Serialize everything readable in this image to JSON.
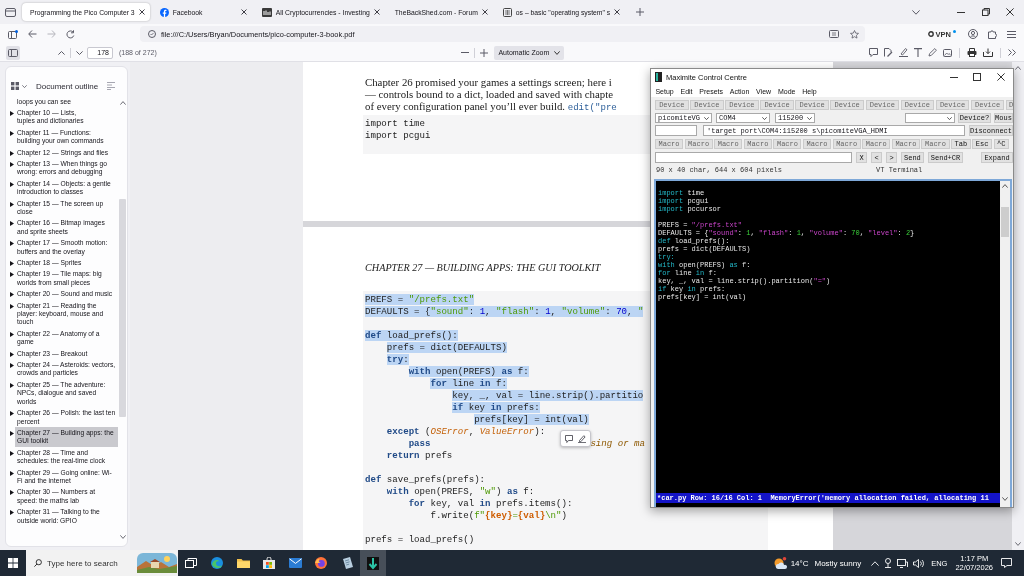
{
  "browser": {
    "tabs": [
      {
        "title": "Programming the Pico Computer 3",
        "kind": "plain",
        "selected": true
      },
      {
        "title": "Facebook",
        "kind": "roundlogo",
        "selected": false
      },
      {
        "title": "All Cryptocurrencies - Investing",
        "kind": "squarelogo",
        "selected": false
      },
      {
        "title": "TheBackShed.com - Forum",
        "kind": "plain",
        "selected": false
      },
      {
        "title": "os – basic \"operating system\" s",
        "kind": "framelogo",
        "selected": false
      }
    ],
    "url": "file:///C:/Users/Bryan/Documents/pico-computer-3-book.pdf",
    "vpn": "VPN"
  },
  "pdf_toolbar": {
    "sidebar_open": true,
    "page": "178",
    "page_count": "(188 of 272)",
    "zoom": "Automatic Zoom"
  },
  "outline": {
    "title": "Document outline",
    "items": [
      {
        "kind": "tail",
        "lines": [
          "loops you can see"
        ],
        "selected": false
      },
      {
        "kind": "chapter",
        "lines": [
          "Chapter 10 — Lists,",
          "tuples and dictionaries"
        ],
        "selected": false
      },
      {
        "kind": "chapter",
        "lines": [
          "Chapter 11 — Functions:",
          "building your own commands"
        ],
        "selected": false
      },
      {
        "kind": "chapter",
        "lines": [
          "Chapter 12 — Strings and files"
        ],
        "selected": false
      },
      {
        "kind": "chapter",
        "lines": [
          "Chapter 13 — When things go",
          "wrong: errors and debugging"
        ],
        "selected": false
      },
      {
        "kind": "chapter",
        "lines": [
          "Chapter 14 — Objects: a gentle",
          "introduction to classes"
        ],
        "selected": false
      },
      {
        "kind": "chapter",
        "lines": [
          "Chapter 15 — The screen up",
          "close"
        ],
        "selected": false
      },
      {
        "kind": "chapter",
        "lines": [
          "Chapter 16 — Bitmap images",
          "and sprite sheets"
        ],
        "selected": false
      },
      {
        "kind": "chapter",
        "lines": [
          "Chapter 17 — Smooth motion:",
          "buffers and the overlay"
        ],
        "selected": false
      },
      {
        "kind": "chapter",
        "lines": [
          "Chapter 18 — Sprites"
        ],
        "selected": false
      },
      {
        "kind": "chapter",
        "lines": [
          "Chapter 19 — Tile maps: big",
          "worlds from small pieces"
        ],
        "selected": false
      },
      {
        "kind": "chapter",
        "lines": [
          "Chapter 20 — Sound and music"
        ],
        "selected": false
      },
      {
        "kind": "chapter",
        "lines": [
          "Chapter 21 — Reading the",
          "player: keyboard, mouse and",
          "touch"
        ],
        "selected": false
      },
      {
        "kind": "chapter",
        "lines": [
          "Chapter 22 — Anatomy of a",
          "game"
        ],
        "selected": false
      },
      {
        "kind": "chapter",
        "lines": [
          "Chapter 23 — Breakout"
        ],
        "selected": false
      },
      {
        "kind": "chapter",
        "lines": [
          "Chapter 24 — Asteroids: vectors,",
          "crowds and particles"
        ],
        "selected": false
      },
      {
        "kind": "chapter",
        "lines": [
          "Chapter 25 — The adventure:",
          "NPCs, dialogue and saved",
          "worlds"
        ],
        "selected": false
      },
      {
        "kind": "chapter",
        "lines": [
          "Chapter 26 — Polish: the last ten",
          "percent"
        ],
        "selected": false
      },
      {
        "kind": "chapter",
        "lines": [
          "Chapter 27 — Building apps: the",
          "GUI toolkit"
        ],
        "selected": true
      },
      {
        "kind": "chapter",
        "lines": [
          "Chapter 28 — Time and",
          "schedules: the real-time clock"
        ],
        "selected": false
      },
      {
        "kind": "chapter",
        "lines": [
          "Chapter 29 — Going online: Wi-",
          "Fi and the internet"
        ],
        "selected": false
      },
      {
        "kind": "chapter",
        "lines": [
          "Chapter 30 — Numbers at",
          "speed: the maths lab"
        ],
        "selected": false
      },
      {
        "kind": "chapter",
        "lines": [
          "Chapter 31 — Talking to the",
          "outside world: GPIO"
        ],
        "selected": false
      }
    ]
  },
  "page_top": {
    "paragraph": [
      [
        {
          "kind": "text",
          "text": "Chapter 26 promised your games a settings screen; here i"
        }
      ],
      [
        {
          "kind": "text",
          "text": "— controls bound to a dict, loaded and saved with chapte"
        }
      ],
      [
        {
          "kind": "text",
          "text": "of every configuration panel you’ll ever build. "
        },
        {
          "kind": "code",
          "text": "edit(\"pre"
        }
      ]
    ],
    "code": [
      {
        "kind": "code",
        "selected": false,
        "tokens": [
          {
            "kind": "name",
            "text": "import time"
          }
        ]
      },
      {
        "kind": "code",
        "selected": false,
        "tokens": [
          {
            "kind": "name",
            "text": "import pcgui"
          }
        ]
      }
    ]
  },
  "page_bottom": {
    "heading": "CHAPTER 27 — BUILDING APPS: THE GUI TOOLKIT",
    "code": [
      {
        "kind": "code",
        "selected": true,
        "tokens": [
          {
            "kind": "name",
            "text": "PREFS = "
          },
          {
            "kind": "str",
            "text": "\"/prefs.txt\""
          }
        ]
      },
      {
        "kind": "code",
        "selected": true,
        "tokens": [
          {
            "kind": "name",
            "text": "DEFAULTS = {"
          },
          {
            "kind": "str",
            "text": "\"sound\""
          },
          {
            "kind": "name",
            "text": ": "
          },
          {
            "kind": "num",
            "text": "1"
          },
          {
            "kind": "name",
            "text": ", "
          },
          {
            "kind": "str",
            "text": "\"flash\""
          },
          {
            "kind": "name",
            "text": ": "
          },
          {
            "kind": "num",
            "text": "1"
          },
          {
            "kind": "name",
            "text": ", "
          },
          {
            "kind": "str",
            "text": "\"volume\""
          },
          {
            "kind": "name",
            "text": ": "
          },
          {
            "kind": "num",
            "text": "70"
          },
          {
            "kind": "name",
            "text": ", "
          },
          {
            "kind": "str",
            "text": "\""
          }
        ]
      },
      {
        "kind": "blank"
      },
      {
        "kind": "code",
        "selected": true,
        "tokens": [
          {
            "kind": "kw",
            "text": "def"
          },
          {
            "kind": "name",
            "text": " load_prefs():"
          }
        ],
        "children": [
          {
            "kind": "code",
            "selected": true,
            "tokens": [
              {
                "kind": "name",
                "text": "prefs = dict(DEFAULTS)"
              }
            ]
          },
          {
            "kind": "code",
            "selected": true,
            "tokens": [
              {
                "kind": "kw",
                "text": "try"
              },
              {
                "kind": "name",
                "text": ":"
              }
            ],
            "children": [
              {
                "kind": "code",
                "selected": true,
                "tokens": [
                  {
                    "kind": "kw",
                    "text": "with"
                  },
                  {
                    "kind": "name",
                    "text": " open(PREFS) "
                  },
                  {
                    "kind": "kw",
                    "text": "as"
                  },
                  {
                    "kind": "name",
                    "text": " f:"
                  }
                ],
                "children": [
                  {
                    "kind": "code",
                    "selected": true,
                    "tokens": [
                      {
                        "kind": "kw",
                        "text": "for"
                      },
                      {
                        "kind": "name",
                        "text": " line "
                      },
                      {
                        "kind": "kw",
                        "text": "in"
                      },
                      {
                        "kind": "name",
                        "text": " f:"
                      }
                    ],
                    "children": [
                      {
                        "kind": "code",
                        "selected": true,
                        "tokens": [
                          {
                            "kind": "name",
                            "text": "key, _, val = line.strip().partitio"
                          }
                        ]
                      },
                      {
                        "kind": "code",
                        "selected": true,
                        "tokens": [
                          {
                            "kind": "kw",
                            "text": "if"
                          },
                          {
                            "kind": "name",
                            "text": " key "
                          },
                          {
                            "kind": "kw",
                            "text": "in"
                          },
                          {
                            "kind": "name",
                            "text": " prefs:"
                          }
                        ],
                        "children": [
                          {
                            "kind": "code",
                            "selected": true,
                            "tokens": [
                              {
                                "kind": "name",
                                "text": "prefs[key] = int(val)"
                              }
                            ]
                          }
                        ]
                      }
                    ]
                  }
                ]
              }
            ]
          },
          {
            "kind": "code",
            "selected": false,
            "tokens": [
              {
                "kind": "kw",
                "text": "except"
              },
              {
                "kind": "name",
                "text": " ("
              },
              {
                "kind": "exc",
                "text": "OSError"
              },
              {
                "kind": "name",
                "text": ", "
              },
              {
                "kind": "exc",
                "text": "ValueError"
              },
              {
                "kind": "name",
                "text": "):"
              }
            ],
            "children": [
              {
                "kind": "code",
                "selected": false,
                "tokens": [
                  {
                    "kind": "kw",
                    "text": "pass"
                  },
                  {
                    "kind": "comment",
                    "text": "sing or ma"
                  }
                ]
              }
            ]
          },
          {
            "kind": "code",
            "selected": false,
            "tokens": [
              {
                "kind": "kw",
                "text": "return"
              },
              {
                "kind": "name",
                "text": " prefs"
              }
            ]
          }
        ]
      },
      {
        "kind": "blank"
      },
      {
        "kind": "code",
        "selected": false,
        "tokens": [
          {
            "kind": "kw",
            "text": "def"
          },
          {
            "kind": "name",
            "text": " save_prefs(prefs):"
          }
        ],
        "children": [
          {
            "kind": "code",
            "selected": false,
            "tokens": [
              {
                "kind": "kw",
                "text": "with"
              },
              {
                "kind": "name",
                "text": " open(PREFS, "
              },
              {
                "kind": "str",
                "text": "\"w\""
              },
              {
                "kind": "name",
                "text": ") "
              },
              {
                "kind": "kw",
                "text": "as"
              },
              {
                "kind": "name",
                "text": " f:"
              }
            ],
            "children": [
              {
                "kind": "code",
                "selected": false,
                "tokens": [
                  {
                    "kind": "kw",
                    "text": "for"
                  },
                  {
                    "kind": "name",
                    "text": " key, val "
                  },
                  {
                    "kind": "kw",
                    "text": "in"
                  },
                  {
                    "kind": "name",
                    "text": " prefs.items():"
                  }
                ],
                "children": [
                  {
                    "kind": "code",
                    "selected": false,
                    "tokens": [
                      {
                        "kind": "name",
                        "text": "f.write("
                      },
                      {
                        "kind": "str",
                        "text": "f\""
                      },
                      {
                        "kind": "interp",
                        "text": "{key}"
                      },
                      {
                        "kind": "str",
                        "text": "="
                      },
                      {
                        "kind": "interp",
                        "text": "{val}"
                      },
                      {
                        "kind": "str",
                        "text": "\\n\""
                      },
                      {
                        "kind": "name",
                        "text": ")"
                      }
                    ]
                  }
                ]
              }
            ]
          }
        ]
      },
      {
        "kind": "blank"
      },
      {
        "kind": "code",
        "selected": false,
        "tokens": [
          {
            "kind": "name",
            "text": "prefs = load_prefs()"
          }
        ]
      }
    ]
  },
  "maximite": {
    "title": "Maximite Control Centre",
    "menu": [
      "Setup",
      "Edit",
      "Presets",
      "Action",
      "View",
      "Mode",
      "Help"
    ],
    "device_buttons": [
      {
        "label": "Device",
        "disabled": true
      },
      {
        "label": "Device",
        "disabled": true
      },
      {
        "label": "Device",
        "disabled": true
      },
      {
        "label": "Device",
        "disabled": true
      },
      {
        "label": "Device",
        "disabled": true
      },
      {
        "label": "Device",
        "disabled": true
      },
      {
        "label": "Device",
        "disabled": true
      },
      {
        "label": "Device",
        "disabled": true
      },
      {
        "label": "Device",
        "disabled": true
      },
      {
        "label": "Device",
        "disabled": true
      },
      {
        "label": "D",
        "disabled": true
      }
    ],
    "board": "picomiteVG",
    "port": "COM4",
    "baud": "115200",
    "device_query": "Device?",
    "mouse": "Mous",
    "target": "'target port\\COM4:115200 s\\picomiteVGA_HDMI",
    "disconnect": "Disconnect",
    "macro_buttons": [
      {
        "label": "Macro",
        "disabled": true
      },
      {
        "label": "Macro",
        "disabled": true
      },
      {
        "label": "Macro",
        "disabled": true
      },
      {
        "label": "Macro",
        "disabled": true
      },
      {
        "label": "Macro",
        "disabled": true
      },
      {
        "label": "Macro",
        "disabled": true
      },
      {
        "label": "Macro",
        "disabled": true
      },
      {
        "label": "Macro",
        "disabled": true
      },
      {
        "label": "Macro",
        "disabled": true
      },
      {
        "label": "Macro",
        "disabled": true
      },
      {
        "label": "Tab",
        "disabled": false
      },
      {
        "label": "Esc",
        "disabled": false
      },
      {
        "label": "^C",
        "disabled": false
      }
    ],
    "send_buttons": [
      "X",
      "<",
      ">",
      "Send",
      "Send+CR"
    ],
    "expand": "Expand",
    "screen_info": "90 x 40 char, 644 x 604 pixels",
    "terminal_mode": "VT Terminal",
    "terminal": {
      "lines": [
        {
          "kind": "code",
          "tokens": [
            {
              "kind": "kw",
              "text": "import"
            },
            {
              "kind": "text",
              "text": " time"
            }
          ]
        },
        {
          "kind": "code",
          "tokens": [
            {
              "kind": "kw",
              "text": "import"
            },
            {
              "kind": "text",
              "text": " pcgui"
            }
          ]
        },
        {
          "kind": "code",
          "tokens": [
            {
              "kind": "kw",
              "text": "import"
            },
            {
              "kind": "text",
              "text": " pccursor"
            }
          ]
        },
        {
          "kind": "blank"
        },
        {
          "kind": "code",
          "tokens": [
            {
              "kind": "text",
              "text": "PREFS = "
            },
            {
              "kind": "str",
              "text": "\"/prefs.txt\""
            }
          ]
        },
        {
          "kind": "code",
          "tokens": [
            {
              "kind": "text",
              "text": "DEFAULTS = {"
            },
            {
              "kind": "str",
              "text": "\"sound\""
            },
            {
              "kind": "text",
              "text": ": "
            },
            {
              "kind": "num",
              "text": "1"
            },
            {
              "kind": "text",
              "text": ", "
            },
            {
              "kind": "str",
              "text": "\"flash\""
            },
            {
              "kind": "text",
              "text": ": "
            },
            {
              "kind": "num",
              "text": "1"
            },
            {
              "kind": "text",
              "text": ", "
            },
            {
              "kind": "str",
              "text": "\"volume\""
            },
            {
              "kind": "text",
              "text": ": "
            },
            {
              "kind": "num",
              "text": "70"
            },
            {
              "kind": "text",
              "text": ", "
            },
            {
              "kind": "str",
              "text": "\"level\""
            },
            {
              "kind": "text",
              "text": ": "
            },
            {
              "kind": "num",
              "text": "2"
            },
            {
              "kind": "text",
              "text": "}"
            }
          ]
        },
        {
          "kind": "code",
          "tokens": [
            {
              "kind": "kw",
              "text": "def"
            },
            {
              "kind": "text",
              "text": " load_prefs():"
            }
          ]
        },
        {
          "kind": "code",
          "tokens": [
            {
              "kind": "text",
              "text": "prefs = dict(DEFAULTS)"
            }
          ]
        },
        {
          "kind": "code",
          "tokens": [
            {
              "kind": "kw",
              "text": "try:"
            }
          ]
        },
        {
          "kind": "code",
          "tokens": [
            {
              "kind": "kw",
              "text": "with"
            },
            {
              "kind": "text",
              "text": " open(PREFS) "
            },
            {
              "kind": "kw",
              "text": "as"
            },
            {
              "kind": "text",
              "text": " f:"
            }
          ]
        },
        {
          "kind": "code",
          "tokens": [
            {
              "kind": "kw",
              "text": "for"
            },
            {
              "kind": "text",
              "text": " line "
            },
            {
              "kind": "kw",
              "text": "in"
            },
            {
              "kind": "text",
              "text": " f:"
            }
          ]
        },
        {
          "kind": "code",
          "tokens": [
            {
              "kind": "text",
              "text": "key, _, val = line.strip().partition("
            },
            {
              "kind": "str",
              "text": "\"=\""
            },
            {
              "kind": "text",
              "text": ")"
            }
          ]
        },
        {
          "kind": "code",
          "tokens": [
            {
              "kind": "kw",
              "text": "if"
            },
            {
              "kind": "text",
              "text": " key "
            },
            {
              "kind": "kw",
              "text": "in"
            },
            {
              "kind": "text",
              "text": " prefs:"
            }
          ]
        },
        {
          "kind": "code",
          "tokens": [
            {
              "kind": "text",
              "text": "prefs[key] = int(val)"
            }
          ]
        }
      ],
      "status": "*car.py Row: 16/16 Col: 1  MemoryError('memory allocation failed, allocating 11"
    }
  },
  "taskbar": {
    "search_placeholder": "Type here to search",
    "apps": [
      {
        "kind": "taskview",
        "selected": false
      },
      {
        "kind": "edge",
        "selected": false
      },
      {
        "kind": "folder",
        "selected": false
      },
      {
        "kind": "store",
        "selected": false
      },
      {
        "kind": "mail",
        "selected": false
      },
      {
        "kind": "firefox",
        "selected": false
      },
      {
        "kind": "notes",
        "selected": false
      },
      {
        "kind": "maximite",
        "selected": true
      }
    ],
    "weather": {
      "temperature": "14°C",
      "summary": "Mostly sunny"
    },
    "language": "ENG",
    "time": "1:17 PM",
    "date": "22/07/2026"
  }
}
